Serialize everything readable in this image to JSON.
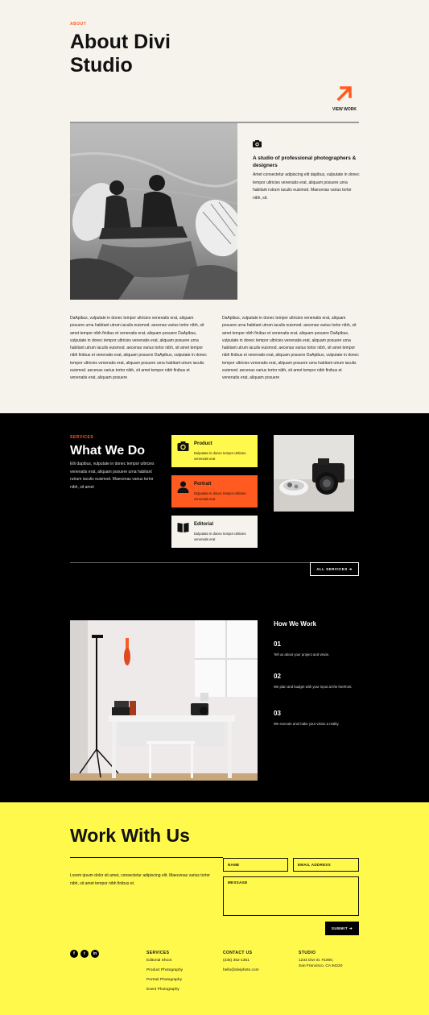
{
  "about": {
    "eyebrow": "ABOUT",
    "title_line1": "About Divi",
    "title_line2": "Studio",
    "view_work": "VIEW WORK",
    "studio_heading": "A studio of professional photographers & designers",
    "studio_body": "Amet consectetur adipiscing elit dapibus, vulputate in donec tempor ultricies venenatis erat, aliquam posuere urna habitant rutrum iaculis euismod. Maecenas varius tortor nibh, sit.",
    "col1": "DaApibus, vulputate in donec tempor ultricies venenatis erat, aliquam posuere urna habitant utrum iaculis euismod. aecenas varius tortor nibh, sit amet tempor nibh finibus et venenatis erat, aliquam posuere DaApibus, vulputate in donec tempor ultricies venenatis erat, aliquam posuere urna habitant utrum iaculis euismod. aecenas varius tortor nibh, sit amet tempor nibh finibus et venenatis erat, aliquam posuere DaApibus, vulputate in donec tempor ultricies venenatis erat, aliquam posuere urna habitant utrum iaculis euismod. aecenas varius tortor nibh, sit amet tempor nibh finibus et venenatis erat, aliquam posuere",
    "col2": "DaApibus, vulputate in donec tempor ultricies venenatis erat, aliquam posuere urna habitant utrum iaculis euismod. aecenas varius tortor nibh, sit amet tempor nibh finibus et venenatis erat, aliquam posuere DaApibus, vulputate in donec tempor ultricies venenatis erat, aliquam posuere urna habitant utrum iaculis euismod. aecenas varius tortor nibh, sit amet tempor nibh finibus et venenatis erat, aliquam posuere DaApibus, vulputate in donec tempor ultricies venenatis erat, aliquam posuere urna habitant utrum iaculis euismod. aecenas varius tortor nibh, sit amet tempor nibh finibus et venenatis erat, aliquam posuere"
  },
  "services": {
    "eyebrow": "SERVICES",
    "title": "What We Do",
    "body": "Elit dapibus, vulputate in donec tempor ultricies venenatis erat, aliquam posuere urna habitant rutrum iaculis euismod. Maecenas varius tortor nibh, sit amet",
    "cards": [
      {
        "title": "Product",
        "desc": "Dulputate in donec tempor ultricies venenatis erat",
        "icon": "camera-icon",
        "color": "#fff94c"
      },
      {
        "title": "Portrait",
        "desc": "Dulputate in donec tempor ultricies venenatis erat",
        "icon": "person-icon",
        "color": "#ff5a1f"
      },
      {
        "title": "Editorial",
        "desc": "Dulputate in donec tempor ultricies venenatis erat",
        "icon": "book-icon",
        "color": "#f6f3ec"
      }
    ],
    "all_services": "ALL SERVICES ➔"
  },
  "how_we_work": {
    "title": "How We Work",
    "steps": [
      {
        "num": "01",
        "text": "Tell us about your project and vision."
      },
      {
        "num": "02",
        "text": "We plan and budget with your input at the forefront."
      },
      {
        "num": "03",
        "text": "We execute and make your vision a reality."
      }
    ]
  },
  "contact": {
    "title": "Work With Us",
    "body": "Lorem ipsum dolor sit amet, consectetur adipiscing elit. Maecenas varius tortor nibh, sit amet tempor nibh finibus et.",
    "name_placeholder": "NAME",
    "email_placeholder": "EMAIL ADDRESS",
    "message_placeholder": "MESSAGE",
    "submit": "SUBMIT ➔"
  },
  "footer": {
    "social": [
      {
        "icon": "facebook-icon",
        "glyph": "f"
      },
      {
        "icon": "twitter-icon",
        "glyph": "t"
      },
      {
        "icon": "linkedin-icon",
        "glyph": "in"
      }
    ],
    "services_head": "SERVICES",
    "services_items": [
      "Editorial Shoot",
      "Product Photography",
      "Portrait Photography",
      "Event Photography"
    ],
    "contact_head": "CONTACT US",
    "phone": "(235) 352-1351",
    "email": "hello@diviphoto.com",
    "studio_head": "STUDIO",
    "address_line1": "1234 Divi St. #1000,",
    "address_line2": "San Francisco, CA 94220"
  },
  "colors": {
    "accent_orange": "#ff5a1f",
    "accent_yellow": "#fff94c",
    "cream": "#f6f3ec",
    "black": "#000000"
  }
}
